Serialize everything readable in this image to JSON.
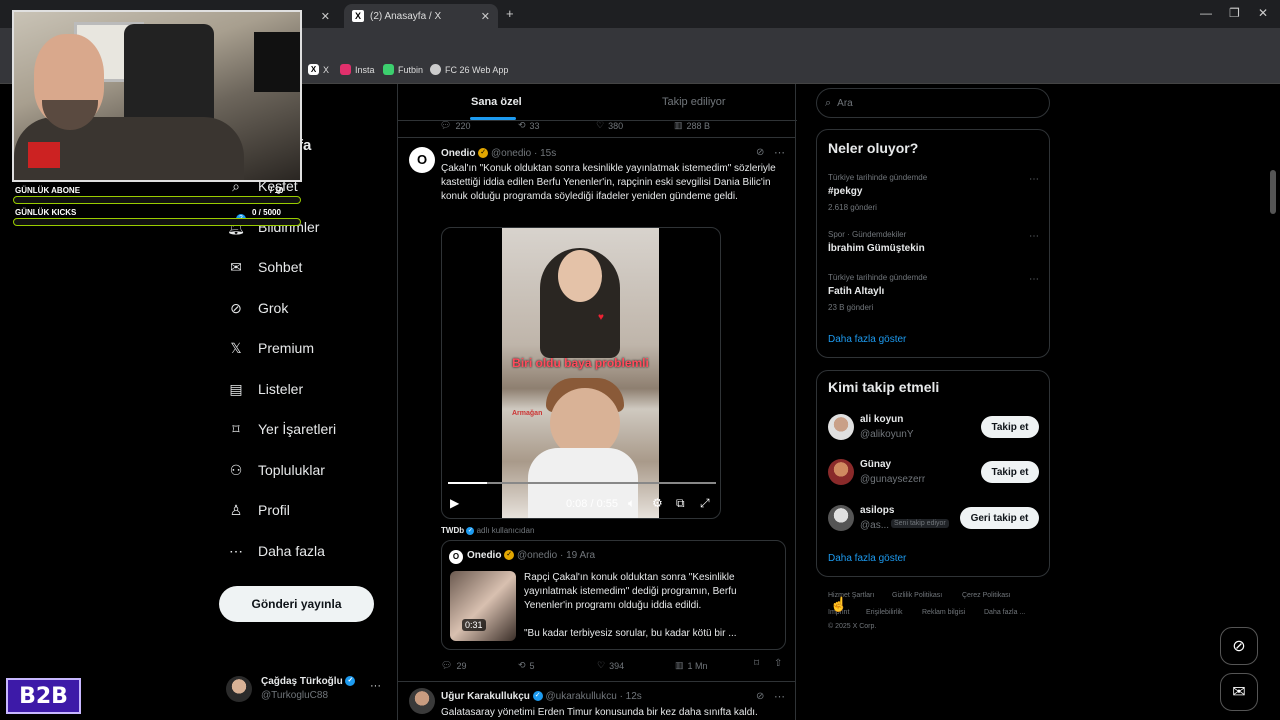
{
  "browser": {
    "tabs": [
      {
        "title": "",
        "icon": "x-icon"
      },
      {
        "title": "(2) Anasayfa / X",
        "icon": "x-icon"
      }
    ],
    "new_tab": "+",
    "bookmarks": [
      {
        "label": "X",
        "icon": "x-icon"
      },
      {
        "label": "Insta",
        "icon": "instagram-icon",
        "color": "#e1306c"
      },
      {
        "label": "Futbin",
        "icon": "futbin-icon",
        "color": "#3ccf6e"
      },
      {
        "label": "FC 26 Web App",
        "icon": "globe-icon",
        "color": "#cccccc"
      }
    ]
  },
  "stream_overlay": {
    "bars": [
      {
        "label": "GÜNLÜK ABONE",
        "value": "/ 10"
      },
      {
        "label": "GÜNLÜK KICKS",
        "value": "0  / 5000"
      }
    ],
    "badge": "B2B"
  },
  "sidebar": {
    "partial_title": "fa",
    "items": [
      {
        "label": "Keşfet",
        "icon": "search-icon"
      },
      {
        "label": "Bildirimler",
        "icon": "bell-icon",
        "badge": "2"
      },
      {
        "label": "Sohbet",
        "icon": "mail-icon"
      },
      {
        "label": "Grok",
        "icon": "grok-icon"
      },
      {
        "label": "Premium",
        "icon": "x-icon"
      },
      {
        "label": "Listeler",
        "icon": "list-icon"
      },
      {
        "label": "Yer İşaretleri",
        "icon": "bookmark-icon"
      },
      {
        "label": "Topluluklar",
        "icon": "communities-icon"
      },
      {
        "label": "Profil",
        "icon": "person-icon"
      },
      {
        "label": "Daha fazla",
        "icon": "more-circle-icon"
      }
    ],
    "post_button": "Gönderi yayınla",
    "profile": {
      "name": "Çağdaş Türkoğlu",
      "handle": "@TurkogluC88",
      "more": "···"
    }
  },
  "feed": {
    "tabs": [
      {
        "label": "Sana özel",
        "active": true
      },
      {
        "label": "Takip ediliyor",
        "active": false
      }
    ],
    "prev_stats": {
      "replies": "220",
      "reposts": "33",
      "likes": "380",
      "views": "288 B"
    },
    "tweet1": {
      "name": "Onedio",
      "handle": "@onedio",
      "time": "· 15s",
      "text": "Çakal'ın \"Konuk olduktan sonra kesinlikle yayınlatmak istemedim\" sözleriyle kastettiği iddia edilen Berfu Yenenler'in, rapçinin eski sevgilisi Dania Bilic'in konuk olduğu programda söylediği ifadeler yeniden gündeme geldi.",
      "video": {
        "caption": "Biri oldu baya problemli",
        "time": "0:08 / 0:55",
        "progress": 0.145,
        "watermark": "Armağan"
      },
      "retweeted_by": "TWDb",
      "retweeted_suffix": "adlı kullanıcıdan",
      "quote": {
        "name": "Onedio",
        "handle": "@onedio",
        "time": "· 19 Ara",
        "text": "Rapçi Çakal'ın konuk olduktan sonra \"Kesinlikle yayınlatmak istemedim\" dediği programın, Berfu Yenenler'in programı olduğu iddia edildi.",
        "text2": "\"Bu kadar terbiyesiz sorular, bu kadar kötü bir ...",
        "thumb_duration": "0:31"
      },
      "stats": {
        "replies": "29",
        "reposts": "5",
        "likes": "394",
        "views": "1 Mn"
      }
    },
    "tweet2": {
      "name": "Uğur Karakullukçu",
      "handle": "@ukarakullukcu",
      "time": "· 12s",
      "text": "Galatasaray yönetimi Erden Timur konusunda bir kez daha sınıfta kaldı."
    }
  },
  "right": {
    "search_placeholder": "Ara",
    "trends": {
      "title": "Neler oluyor?",
      "items": [
        {
          "meta": "Türkiye tarihinde gündemde",
          "name": "#pekgy",
          "count": "2.618 gönderi"
        },
        {
          "meta": "Spor · Gündemdekiler",
          "name": "İbrahim Gümüştekin",
          "count": ""
        },
        {
          "meta": "Türkiye tarihinde gündemde",
          "name": "Fatih Altaylı",
          "count": "23 B gönderi"
        }
      ],
      "more": "Daha fazla göster"
    },
    "who_to_follow": {
      "title": "Kimi takip etmeli",
      "users": [
        {
          "name": "ali koyun",
          "handle": "@alikoyunY",
          "button": "Takip et",
          "follows_you": ""
        },
        {
          "name": "Günay",
          "handle": "@gunaysezerr",
          "button": "Takip et",
          "follows_you": ""
        },
        {
          "name": "asilops",
          "handle": "@as...",
          "button": "Geri takip et",
          "follows_you": "Seni takip ediyor"
        }
      ],
      "more": "Daha fazla göster"
    },
    "footer": {
      "links": [
        "Hizmet Şartları",
        "Gizlilik Politikası",
        "Çerez Politikası",
        "Imprint",
        "Erişilebilirlik",
        "Reklam bilgisi",
        "Daha fazla ..."
      ],
      "copyright": "© 2025 X Corp."
    }
  }
}
